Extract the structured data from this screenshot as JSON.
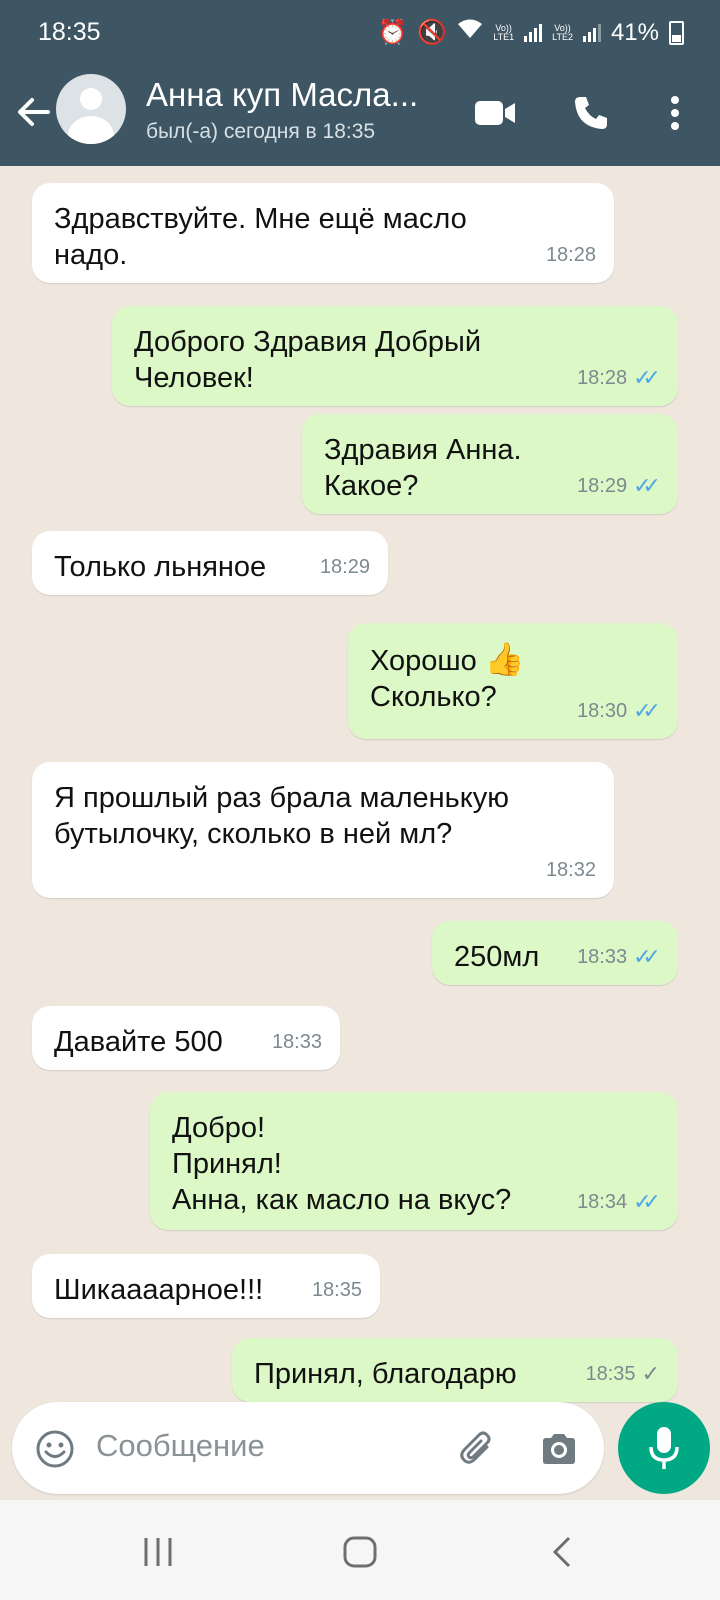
{
  "status_bar": {
    "time": "18:35",
    "battery": "41%",
    "sim1": "LTE1",
    "sim2": "LTE2",
    "volte": "Vo))"
  },
  "header": {
    "contact_name": "Анна куп Масла...",
    "last_seen": "был(-а) сегодня в 18:35"
  },
  "messages": [
    {
      "dir": "in",
      "text": "Здравствуйте. Мне ещё масло\nнадо.",
      "time": "18:28"
    },
    {
      "dir": "out",
      "text": "Доброго Здравия Добрый\nЧеловек!",
      "time": "18:28",
      "status": "read"
    },
    {
      "dir": "out",
      "text": "Здравия Анна.\nКакое?",
      "time": "18:29",
      "status": "read"
    },
    {
      "dir": "in",
      "text": "Только льняное",
      "time": "18:29"
    },
    {
      "dir": "out",
      "text": "Хорошо",
      "emoji": "👍",
      "text2": "Сколько?",
      "time": "18:30",
      "status": "read"
    },
    {
      "dir": "in",
      "text": "Я прошлый раз брала маленькую\nбутылочку,  сколько в ней мл?",
      "time": "18:32"
    },
    {
      "dir": "out",
      "text": "250мл",
      "time": "18:33",
      "status": "read"
    },
    {
      "dir": "in",
      "text": "Давайте 500",
      "time": "18:33"
    },
    {
      "dir": "out",
      "text": "Добро!\nПринял!\nАнна, как масло на вкус?",
      "time": "18:34",
      "status": "read"
    },
    {
      "dir": "in",
      "text": "Шикаааарное!!!",
      "time": "18:35"
    },
    {
      "dir": "out",
      "text": "Принял,  благодарю",
      "time": "18:35",
      "status": "sent"
    }
  ],
  "composer": {
    "placeholder": "Сообщение"
  },
  "colors": {
    "header": "#3e5663",
    "chat_background": "#efe7de",
    "incoming_bubble": "#ffffff",
    "outgoing_bubble": "#dcf8c6",
    "read_tick": "#4fa7e6",
    "mic_button": "#00a884"
  },
  "icons": [
    "back-arrow-icon",
    "avatar-icon",
    "video-call-icon",
    "phone-icon",
    "more-icon",
    "emoji-icon",
    "attach-icon",
    "camera-icon",
    "mic-icon",
    "recents-icon",
    "home-icon",
    "nav-back-icon"
  ]
}
